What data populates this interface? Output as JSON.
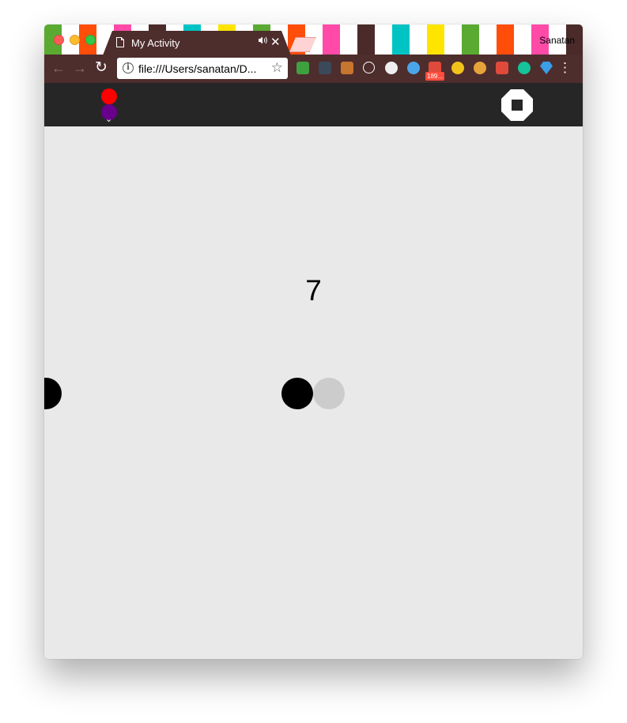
{
  "browser": {
    "tab_title": "My Activity",
    "tab_audio_icon": "speaker-icon",
    "tab_close_glyph": "✕",
    "profile_name": "Sanatan",
    "url": "file:///Users/sanatan/D...",
    "back_glyph": "←",
    "forward_glyph": "→",
    "reload_glyph": "↻",
    "star_glyph": "☆",
    "menu_glyph": "⋮",
    "extension_badge": "189...",
    "extensions": [
      {
        "name": "jsfiddle-icon",
        "color": "#3fa03f"
      },
      {
        "name": "x-close-icon",
        "color": "#3a4a5a"
      },
      {
        "name": "hammer-icon",
        "color": "#c8752f"
      },
      {
        "name": "react-icon",
        "color": "#ffffff"
      },
      {
        "name": "opera-icon",
        "color": "#eeeeee"
      },
      {
        "name": "snowflake-icon",
        "color": "#4aa6e8"
      },
      {
        "name": "gmail-icon",
        "color": "#e04a3a"
      },
      {
        "name": "chrome-icon",
        "color": "#f2c21b"
      },
      {
        "name": "txt-icon",
        "color": "#e8a23a"
      },
      {
        "name": "book-icon",
        "color": "#e04a3a"
      },
      {
        "name": "grammarly-icon",
        "color": "#15c39a"
      },
      {
        "name": "diamond-icon",
        "color": "#3a9ee8"
      }
    ]
  },
  "app": {
    "header_bg": "#262626",
    "color_options": [
      {
        "name": "red",
        "color": "#ff0000"
      },
      {
        "name": "purple",
        "color": "#69008c"
      }
    ],
    "chevron_glyph": "⌄",
    "stop_button_icon": "stop-icon",
    "score": "7",
    "canvas_bg": "#e9e9e9"
  }
}
